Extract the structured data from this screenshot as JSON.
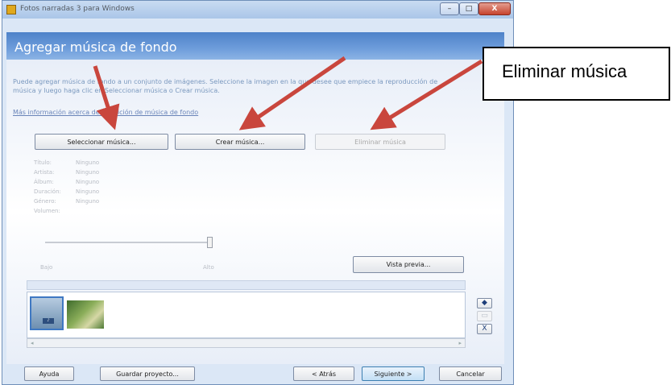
{
  "window": {
    "title": "Fotos narradas 3 para Windows",
    "controls": {
      "minimize": "–",
      "maximize": "□",
      "close": "X"
    }
  },
  "header": {
    "title": "Agregar música de fondo"
  },
  "description": "Puede agregar música de fondo a un conjunto de imágenes. Seleccione la imagen en la que desee que empiece la reproducción de música y luego haga clic en Seleccionar música o Crear música.",
  "info_link": "Más información acerca de la adición de música de fondo",
  "music_buttons": {
    "select": "Seleccionar música...",
    "create": "Crear música...",
    "delete": "Eliminar música"
  },
  "music_info": {
    "rows": [
      {
        "label": "Título:",
        "value": "Ninguno"
      },
      {
        "label": "Artista:",
        "value": "Ninguno"
      },
      {
        "label": "Álbum:",
        "value": "Ninguno"
      },
      {
        "label": "Duración:",
        "value": "Ninguno"
      },
      {
        "label": "Género:",
        "value": "Ninguno"
      },
      {
        "label": "Volumen:",
        "value": ""
      }
    ]
  },
  "volume_slider": {
    "min_label": "Bajo",
    "max_label": "Alto",
    "level": 1.0
  },
  "preview_button": "Vista previa...",
  "filmstrip": {
    "scroll_left": "◂",
    "scroll_right": "▸",
    "thumbnails": [
      "imagen-1",
      "imagen-2"
    ]
  },
  "side_buttons": {
    "move_left": "◆",
    "move_right": "▭",
    "remove": "X"
  },
  "footer": {
    "help": "Ayuda",
    "save_project": "Guardar proyecto...",
    "back": "< Atrás",
    "next": "Siguiente >",
    "cancel": "Cancelar"
  },
  "callout": {
    "text": "Eliminar música"
  },
  "colors": {
    "arrow": "#c9463d",
    "header_blue": "#4d82c9"
  }
}
